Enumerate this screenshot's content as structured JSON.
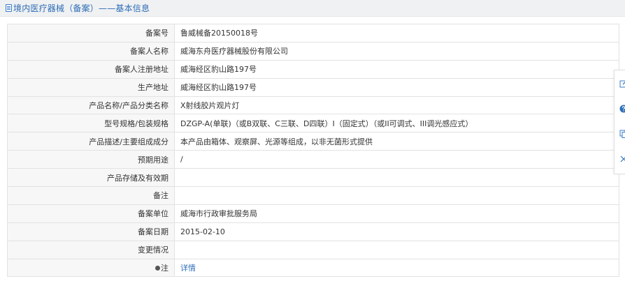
{
  "header": {
    "title": "境内医疗器械（备案）——基本信息",
    "icon": "document-icon"
  },
  "rows": [
    {
      "label": "备案号",
      "value": "鲁威械备20150018号"
    },
    {
      "label": "备案人名称",
      "value": "威海东舟医疗器械股份有限公司"
    },
    {
      "label": "备案人注册地址",
      "value": "威海经区豹山路197号"
    },
    {
      "label": "生产地址",
      "value": "威海经区豹山路197号"
    },
    {
      "label": "产品名称/产品分类名称",
      "value": "X射线胶片观片灯"
    },
    {
      "label": "型号规格/包装规格",
      "value": "DZGP-A(单联)（或B双联、C三联、D四联）I（固定式）（或II可调式、III调光感应式）"
    },
    {
      "label": "产品描述/主要组成成分",
      "value": "本产品由箱体、观察屏、光源等组成，以非无菌形式提供"
    },
    {
      "label": "预期用途",
      "value": "/"
    },
    {
      "label": "产品存储及有效期",
      "value": ""
    },
    {
      "label": "备注",
      "value": ""
    },
    {
      "label": "备案单位",
      "value": "威海市行政审批服务局"
    },
    {
      "label": "备案日期",
      "value": "2015-02-10"
    },
    {
      "label": "变更情况",
      "value": ""
    }
  ],
  "note_row": {
    "label": "注",
    "link_text": "详情"
  },
  "side_panel": {
    "buttons": [
      "edit-icon",
      "help-icon",
      "copy-icon",
      "close-icon"
    ]
  },
  "colors": {
    "title_blue": "#2c6cb5",
    "link_blue": "#2f6fb8",
    "label_bg": "#f7f7f7",
    "border": "#e2e2e2"
  }
}
